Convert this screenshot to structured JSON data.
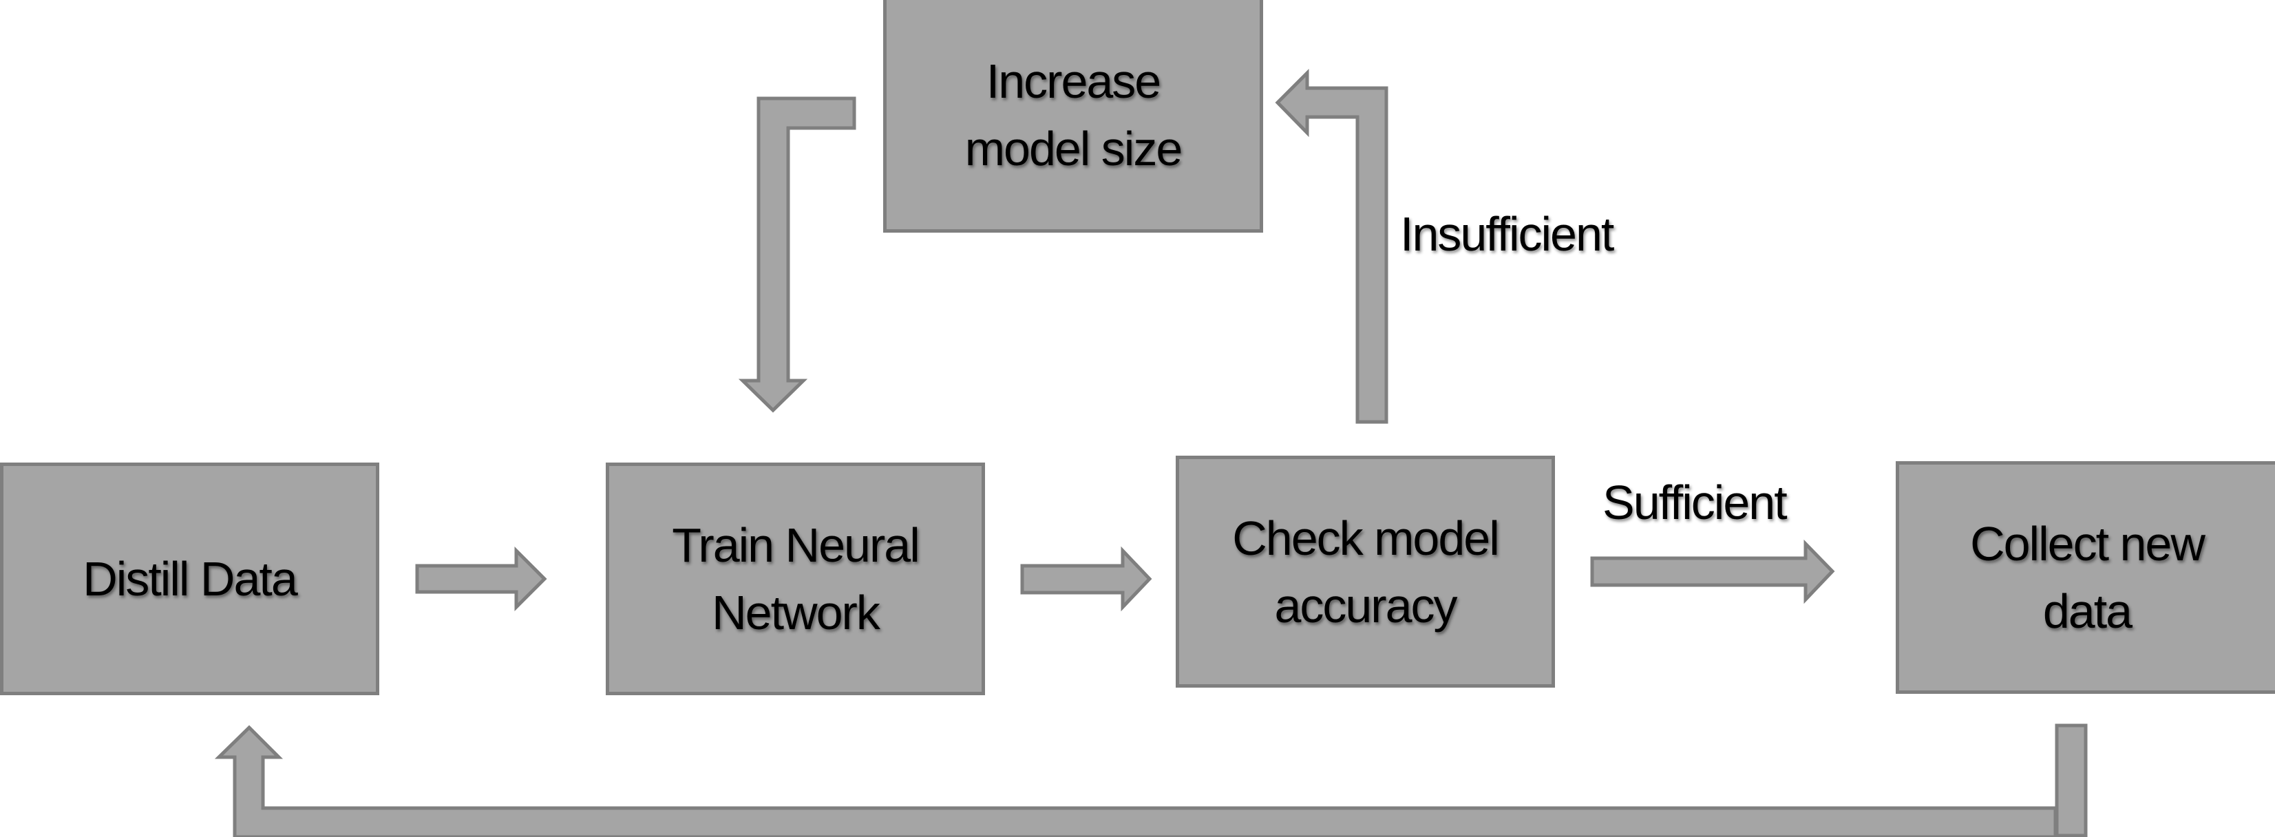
{
  "diagram": {
    "type": "flowchart",
    "colors": {
      "node_fill": "#a5a5a5",
      "node_border": "#7f7f7f",
      "arrow_fill": "#a5a5a5",
      "arrow_border": "#7f7f7f",
      "text": "#000000",
      "background": "#ffffff"
    },
    "nodes": {
      "distill": {
        "id": "distill",
        "label": "Distill Data"
      },
      "train": {
        "id": "train",
        "label": "Train Neural\nNetwork"
      },
      "check": {
        "id": "check",
        "label": "Check model\naccuracy"
      },
      "collect": {
        "id": "collect",
        "label": "Collect new\ndata"
      },
      "increase": {
        "id": "increase",
        "label": "Increase\nmodel size"
      }
    },
    "edges": [
      {
        "from": "distill",
        "to": "train",
        "label": ""
      },
      {
        "from": "train",
        "to": "check",
        "label": ""
      },
      {
        "from": "check",
        "to": "collect",
        "label": "Sufficient"
      },
      {
        "from": "check",
        "to": "increase",
        "label": "Insufficient"
      },
      {
        "from": "increase",
        "to": "train",
        "label": ""
      },
      {
        "from": "collect",
        "to": "distill",
        "label": ""
      }
    ],
    "edge_labels": {
      "sufficient": "Sufficient",
      "insufficient": "Insufficient"
    }
  }
}
